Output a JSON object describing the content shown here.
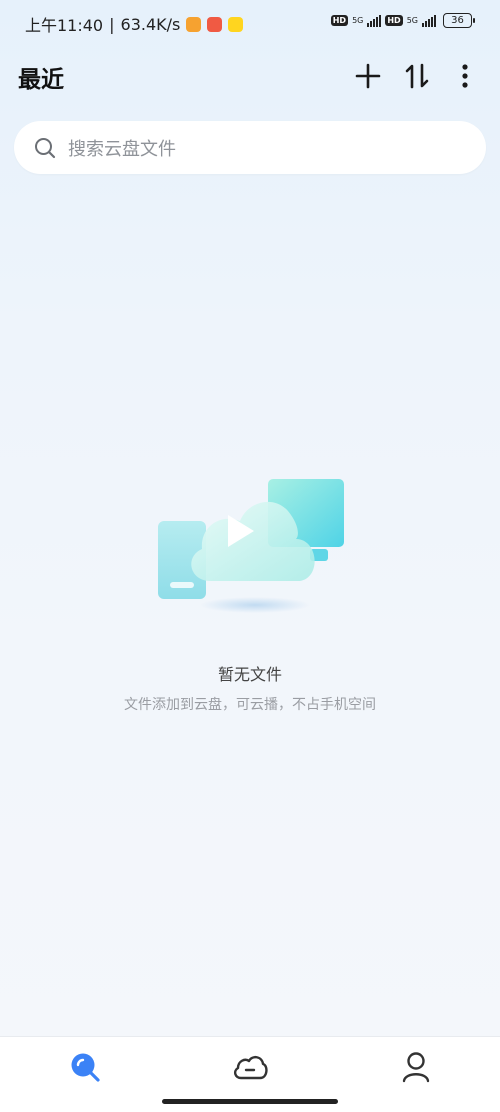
{
  "status_bar": {
    "time": "上午11:40",
    "separator": "|",
    "speed": "63.4K/s",
    "sim1": {
      "hd": "HD",
      "network": "5G"
    },
    "sim2": {
      "hd": "HD",
      "network": "5G"
    },
    "battery": "36"
  },
  "header": {
    "title": "最近",
    "add_icon": "plus-icon",
    "sort_icon": "sort-icon",
    "more_icon": "more-vertical-icon"
  },
  "search": {
    "placeholder": "搜索云盘文件",
    "icon": "search-icon"
  },
  "empty_state": {
    "illustration": "cloud-devices-illustration",
    "title": "暂无文件",
    "subtitle": "文件添加到云盘，可云播，不占手机空间"
  },
  "bottom_nav": {
    "items": [
      {
        "icon": "search-tab-icon",
        "active": true
      },
      {
        "icon": "cloud-tab-icon",
        "active": false
      },
      {
        "icon": "profile-tab-icon",
        "active": false
      }
    ]
  },
  "colors": {
    "accent": "#3b82f6",
    "text_primary": "#111111",
    "text_secondary": "#9a9da3"
  }
}
